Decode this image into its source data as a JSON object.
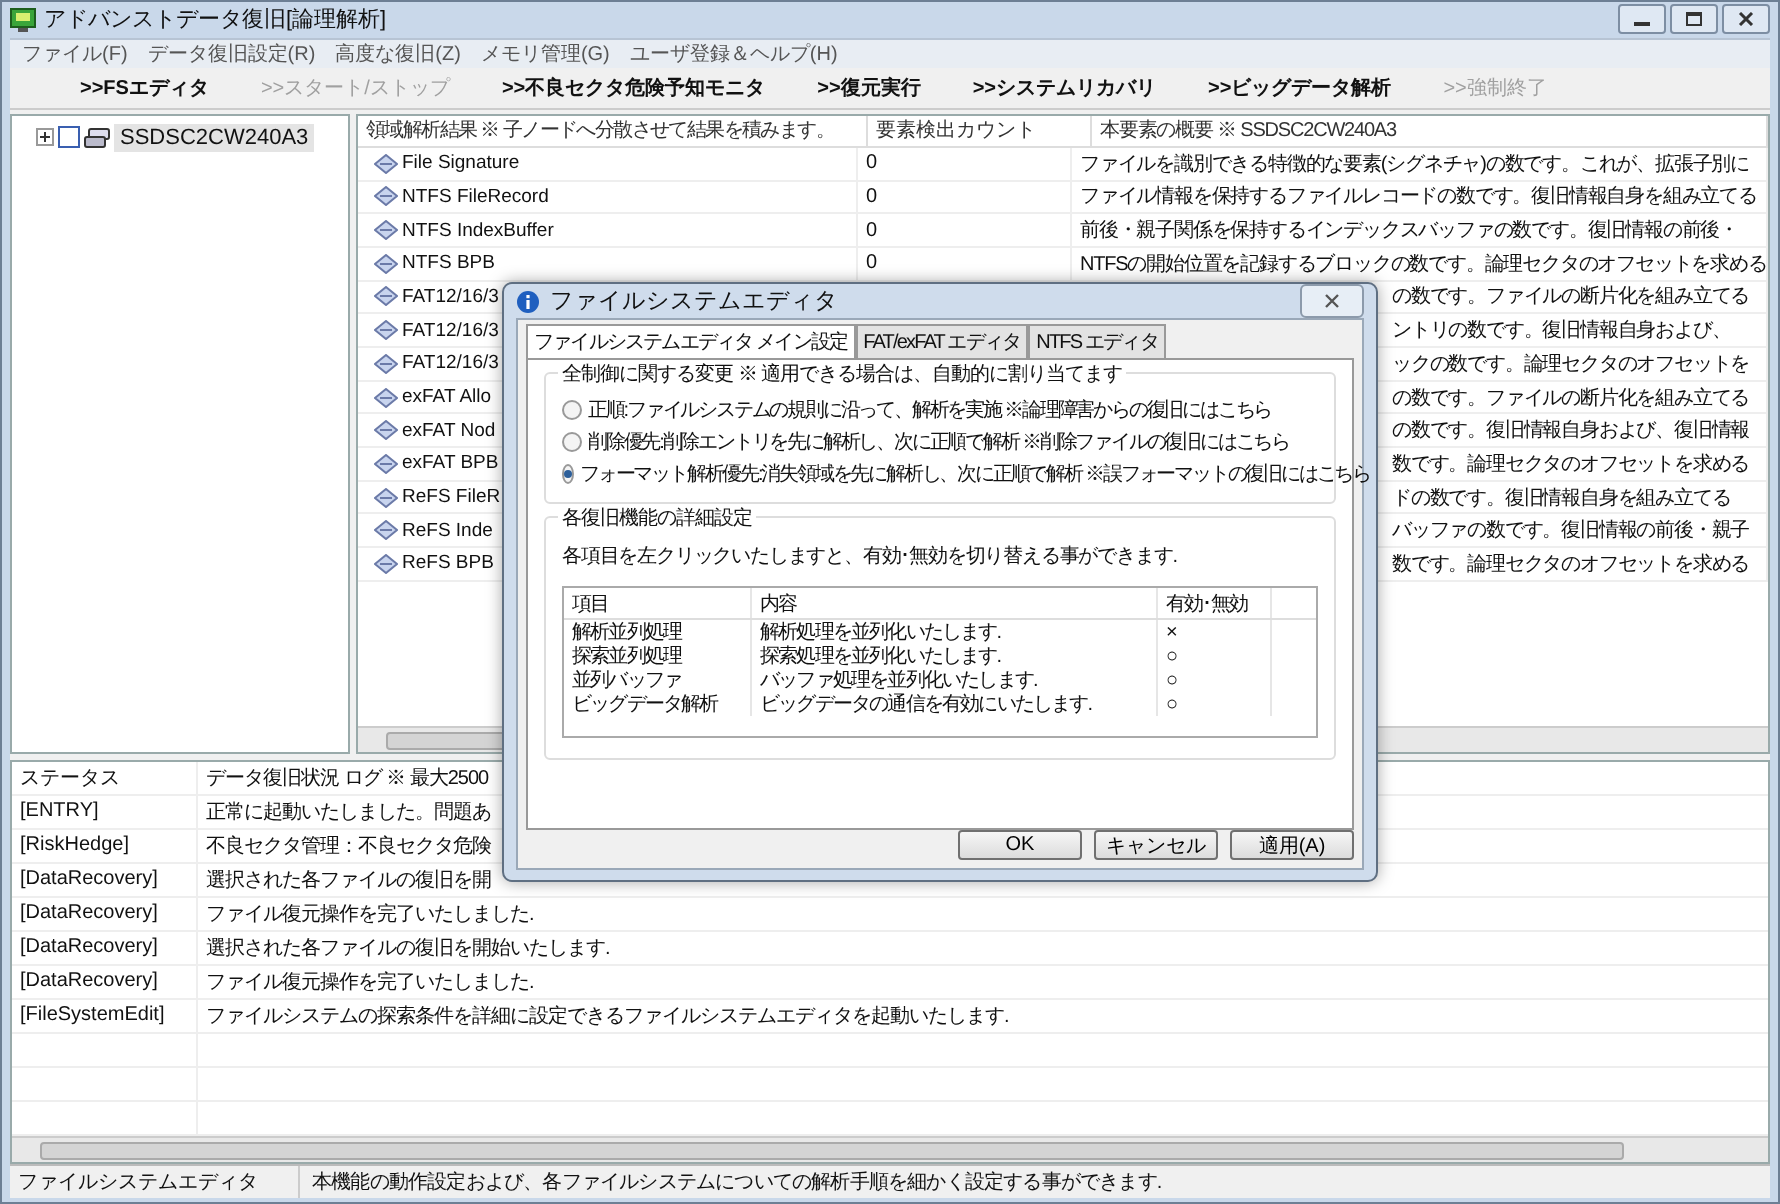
{
  "window": {
    "title": "アドバンストデータ復旧[論理解析]"
  },
  "menu": [
    "ファイル(F)",
    "データ復旧設定(R)",
    "高度な復旧(Z)",
    "メモリ管理(G)",
    "ユーザ登録＆ヘルプ(H)"
  ],
  "toolbar": [
    {
      "label": ">>FSエディタ",
      "disabled": false
    },
    {
      "label": ">>スタート/ストップ",
      "disabled": true
    },
    {
      "label": ">>不良セクタ危険予知モニタ",
      "disabled": false
    },
    {
      "label": ">>復元実行",
      "disabled": false
    },
    {
      "label": ">>システムリカバリ",
      "disabled": false
    },
    {
      "label": ">>ビッグデータ解析",
      "disabled": false
    },
    {
      "label": ">>強制終了",
      "disabled": true
    }
  ],
  "tree": {
    "items": [
      {
        "label": "SSDSC2CW240A3",
        "checked": false,
        "selected": true
      }
    ]
  },
  "table": {
    "columns": [
      "領域解析結果 ※ 子ノードへ分散させて結果を積みます。",
      "要素検出カウント",
      "本要素の概要 ※ SSDSC2CW240A3"
    ],
    "rows": [
      {
        "name": "File Signature",
        "count": "0",
        "summary": "ファイルを識別できる特徴的な要素(シグネチャ)の数です。これが、拡張子別に",
        "covered": false
      },
      {
        "name": "NTFS FileRecord",
        "count": "0",
        "summary": "ファイル情報を保持するファイルレコードの数です。復旧情報自身を組み立てる",
        "covered": false
      },
      {
        "name": "NTFS IndexBuffer",
        "count": "0",
        "summary": "前後・親子関係を保持するインデックスバッファの数です。復旧情報の前後・",
        "covered": false
      },
      {
        "name": "NTFS BPB",
        "count": "0",
        "summary": "NTFSの開始位置を記録するブロックの数です。論理セクタのオフセットを求める",
        "covered": false
      },
      {
        "name": "FAT12/16/3",
        "summary": "の数です。ファイルの断片化を組み立てる",
        "covered": true
      },
      {
        "name": "FAT12/16/3",
        "summary": "ントリの数です。復旧情報自身および、",
        "covered": true
      },
      {
        "name": "FAT12/16/3",
        "summary": "ックの数です。論理セクタのオフセットを",
        "covered": true
      },
      {
        "name": "exFAT Allo",
        "summary": "の数です。ファイルの断片化を組み立てる",
        "covered": true
      },
      {
        "name": "exFAT Nod",
        "summary": "の数です。復旧情報自身および、復旧情報",
        "covered": true
      },
      {
        "name": "exFAT BPB",
        "summary": "数です。論理セクタのオフセットを求める",
        "covered": true
      },
      {
        "name": "ReFS FileR",
        "summary": "ドの数です。復旧情報自身を組み立てる",
        "covered": true
      },
      {
        "name": "ReFS Inde",
        "summary": "バッファの数です。復旧情報の前後・親子",
        "covered": true
      },
      {
        "name": "ReFS BPB",
        "summary": "数です。論理セクタのオフセットを求める",
        "covered": true
      }
    ]
  },
  "log": {
    "columns": [
      "ステータス",
      "データ復旧状況 ログ ※ 最大2500"
    ],
    "rows": [
      {
        "status": "[ENTRY]",
        "message": "正常に起動いたしました。問題あ"
      },
      {
        "status": "[RiskHedge]",
        "message": "不良セクタ管理：不良セクタ危険"
      },
      {
        "status": "[DataRecovery]",
        "message": "選択された各ファイルの復旧を開"
      },
      {
        "status": "[DataRecovery]",
        "message": "ファイル復元操作を完了いたしました."
      },
      {
        "status": "[DataRecovery]",
        "message": "選択された各ファイルの復旧を開始いたします."
      },
      {
        "status": "[DataRecovery]",
        "message": "ファイル復元操作を完了いたしました."
      },
      {
        "status": "[FileSystemEdit]",
        "message": "ファイルシステムの探索条件を詳細に設定できるファイルシステムエディタを起動いたします."
      }
    ]
  },
  "status_bar": [
    "ファイルシステムエディタ",
    "本機能の動作設定および、各ファイルシステムについての解析手順を細かく設定する事ができます."
  ],
  "dialog": {
    "title": "ファイルシステムエディタ",
    "tabs": [
      {
        "label": "ファイルシステムエディタ メイン設定",
        "selected": true
      },
      {
        "label": "FAT/exFAT エディタ",
        "selected": false
      },
      {
        "label": "NTFS エディタ",
        "selected": false
      }
    ],
    "mode_group": {
      "label": "全制御に関する変更 ※ 適用できる場合は、自動的に割り当てます",
      "options": [
        {
          "label": "正順:ファイルシステムの規則に沿って、解析を実施 ※論理障害からの復旧にはこちら",
          "selected": false
        },
        {
          "label": "削除優先:削除エントリを先に解析し、次に正順で解析 ※削除ファイルの復旧にはこちら",
          "selected": false
        },
        {
          "label": "フォーマット解析優先:消失領域を先に解析し、次に正順で解析 ※誤フォーマットの復旧にはこちら",
          "selected": true
        }
      ]
    },
    "detail_group": {
      "label": "各復旧機能の詳細設定",
      "hint": "各項目を左クリックいたしますと、有効･無効を切り替える事ができます.",
      "columns": [
        "項目",
        "内容",
        "有効･無効"
      ],
      "rows": [
        {
          "item": "解析並列処理",
          "content": "解析処理を並列化いたします.",
          "status": "×"
        },
        {
          "item": "探索並列処理",
          "content": "探索処理を並列化いたします.",
          "status": "○"
        },
        {
          "item": "並列バッファ",
          "content": "バッファ処理を並列化いたします.",
          "status": "○"
        },
        {
          "item": "ビッグデータ解析",
          "content": "ビッグデータの通信を有効にいたします.",
          "status": "○"
        }
      ]
    },
    "buttons": [
      "OK",
      "キャンセル",
      "適用(A)"
    ]
  }
}
